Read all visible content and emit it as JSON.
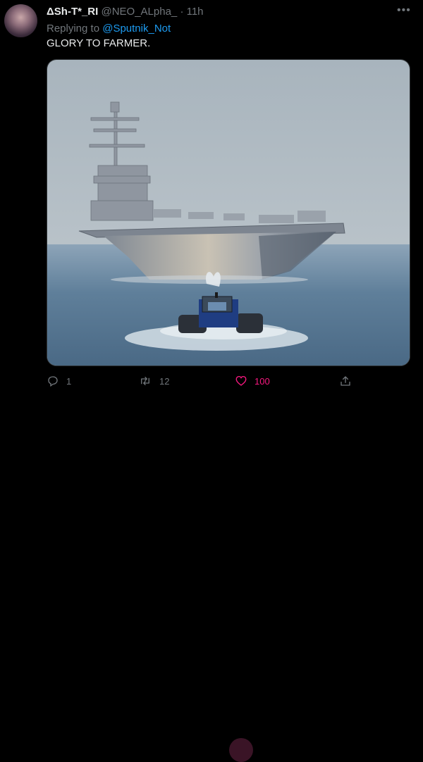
{
  "tweet": {
    "display_name": "ΔSh-T*_RI",
    "handle": "@NEO_ALpha_",
    "separator": "·",
    "time": "11h",
    "more_icon": "more-horizontal-icon",
    "reply_prefix": "Replying to",
    "reply_to": "@Sputnik_Not",
    "text": "GLORY TO FARMER."
  },
  "actions": {
    "reply": {
      "icon": "reply-icon",
      "count": "1"
    },
    "retweet": {
      "icon": "retweet-icon",
      "count": "12"
    },
    "like": {
      "icon": "heart-icon",
      "count": "100",
      "color": "#f91880"
    },
    "share": {
      "icon": "share-icon"
    }
  },
  "colors": {
    "background": "#000000",
    "accent": "#1d9bf0",
    "muted": "#71767b",
    "like": "#f91880"
  }
}
